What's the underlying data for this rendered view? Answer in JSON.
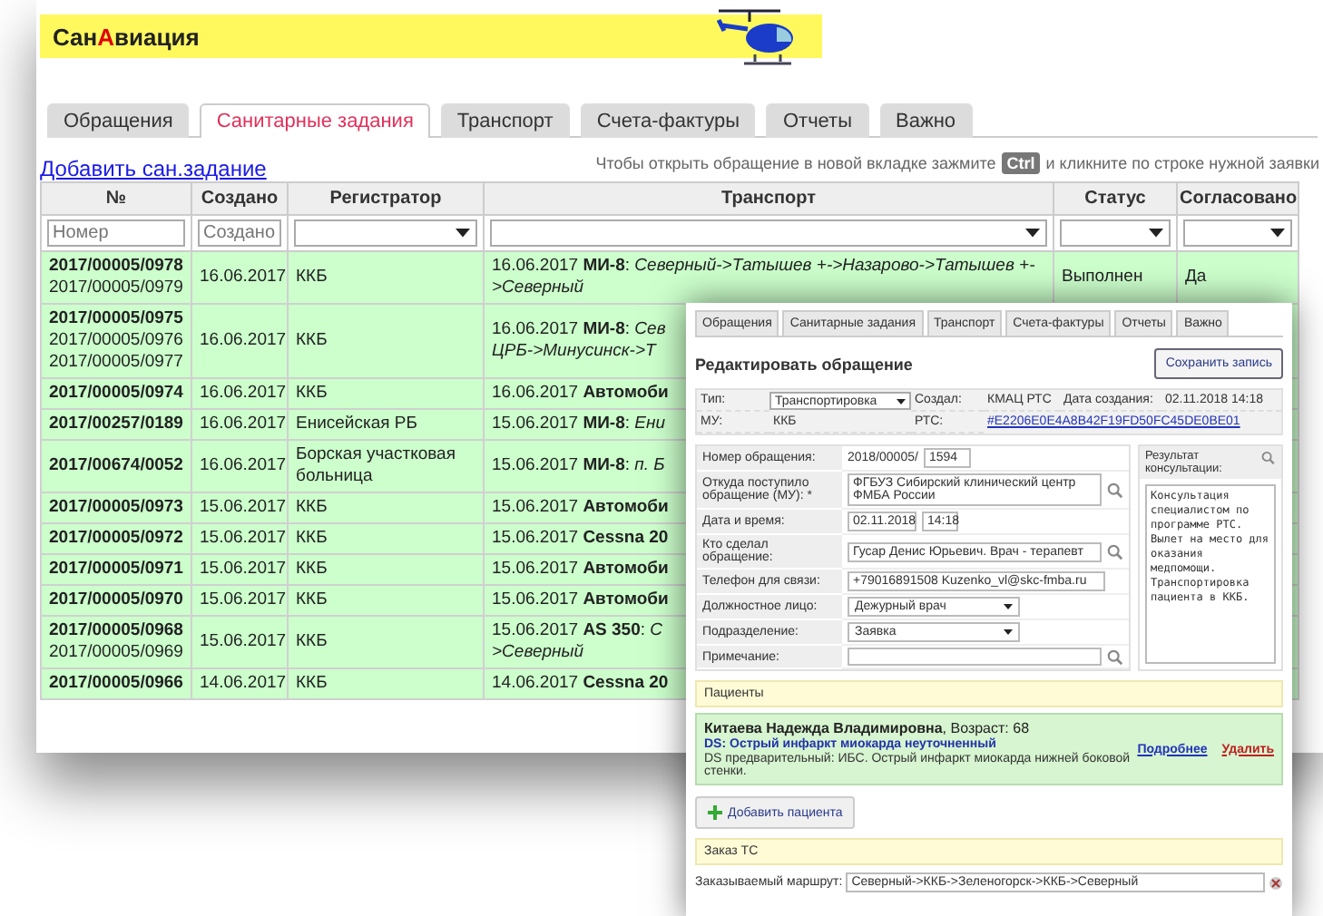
{
  "app": {
    "logo": {
      "before": "Сан",
      "accent": "А",
      "after": "виация"
    },
    "tabs": [
      {
        "label": "Обращения",
        "selected": false
      },
      {
        "label": "Санитарные задания",
        "selected": true
      },
      {
        "label": "Транспорт",
        "selected": false
      },
      {
        "label": "Счета-фактуры",
        "selected": false
      },
      {
        "label": "Отчеты",
        "selected": false
      },
      {
        "label": "Важно",
        "selected": false
      }
    ],
    "add_link": "Добавить сан.задание",
    "hint": {
      "before": "Чтобы открыть обращение в новой вкладке зажмите",
      "key": "Ctrl",
      "after": "и кликните по строке нужной заявки"
    },
    "table": {
      "columns": [
        "№",
        "Создано",
        "Регистратор",
        "Транспорт",
        "Статус",
        "Согласовано"
      ],
      "filters": [
        {
          "kind": "input",
          "placeholder": "Номер"
        },
        {
          "kind": "input",
          "placeholder": "Создано"
        },
        {
          "kind": "select"
        },
        {
          "kind": "select"
        },
        {
          "kind": "select"
        },
        {
          "kind": "select"
        }
      ],
      "rows": [
        {
          "numbers": [
            "2017/00005/0978",
            "2017/00005/0979"
          ],
          "created": "16.06.2017",
          "registrar": "ККБ",
          "transport": [
            "16.06.2017 **МИ-8**: *Северный->Татышев +->Назарово->Татышев +-*",
            "*>Северный*"
          ],
          "status": "Выполнен",
          "agreed": "Да"
        },
        {
          "numbers": [
            "2017/00005/0975",
            "2017/00005/0976",
            "2017/00005/0977"
          ],
          "created": "16.06.2017",
          "registrar": "ККБ",
          "transport": [
            "16.06.2017 **МИ-8**: *Сев*",
            "*ЦРБ->Минусинск->Т*"
          ]
        },
        {
          "numbers": [
            "2017/00005/0974"
          ],
          "created": "16.06.2017",
          "registrar": "ККБ",
          "transport": [
            "16.06.2017 **Автомоби**"
          ]
        },
        {
          "numbers": [
            "2017/00257/0189"
          ],
          "created": "16.06.2017",
          "registrar": "Енисейская РБ",
          "transport": [
            "15.06.2017 **МИ-8**: *Ени*"
          ]
        },
        {
          "numbers": [
            "2017/00674/0052"
          ],
          "created": "16.06.2017",
          "registrar": "Борская участковая больница",
          "transport": [
            "15.06.2017 **МИ-8**: *п. Б*"
          ]
        },
        {
          "numbers": [
            "2017/00005/0973"
          ],
          "created": "15.06.2017",
          "registrar": "ККБ",
          "transport": [
            "15.06.2017 **Автомоби**"
          ]
        },
        {
          "numbers": [
            "2017/00005/0972"
          ],
          "created": "15.06.2017",
          "registrar": "ККБ",
          "transport": [
            "15.06.2017 **Cessna 20**"
          ]
        },
        {
          "numbers": [
            "2017/00005/0971"
          ],
          "created": "15.06.2017",
          "registrar": "ККБ",
          "transport": [
            "15.06.2017 **Автомоби**"
          ]
        },
        {
          "numbers": [
            "2017/00005/0970"
          ],
          "created": "15.06.2017",
          "registrar": "ККБ",
          "transport": [
            "15.06.2017 **Автомоби**"
          ]
        },
        {
          "numbers": [
            "2017/00005/0968",
            "2017/00005/0969"
          ],
          "created": "15.06.2017",
          "registrar": "ККБ",
          "transport": [
            "15.06.2017 **AS 350**: *С*",
            "*>Северный*"
          ]
        },
        {
          "numbers": [
            "2017/00005/0966"
          ],
          "created": "14.06.2017",
          "registrar": "ККБ",
          "transport": [
            "14.06.2017 **Cessna 20**"
          ]
        }
      ]
    }
  },
  "editor": {
    "tabs": [
      {
        "label": "Обращения",
        "selected": false
      },
      {
        "label": "Санитарные задания",
        "selected": false
      },
      {
        "label": "Транспорт",
        "selected": false
      },
      {
        "label": "Счета-фактуры",
        "selected": false
      },
      {
        "label": "Отчеты",
        "selected": false
      },
      {
        "label": "Важно",
        "selected": false
      }
    ],
    "title": "Редактировать обращение",
    "save_button": "Сохранить запись",
    "info": {
      "type_label": "Тип:",
      "type_value": "Транспортировка",
      "creator_label": "Создал:",
      "creator": "КМАЦ РТС",
      "created_label": "Дата создания:",
      "created": "02.11.2018 14:18",
      "mu_label": "МУ:",
      "mu": "ККБ",
      "rts_label": "РТС:",
      "rts": "#E2206E0E4A8B42F19FD50FC45DE0BE01"
    },
    "form": [
      {
        "kind": "number",
        "label": "Номер обращения:",
        "prefix": "2018/00005/",
        "value": "1594"
      },
      {
        "kind": "lookup",
        "label": "Откуда поступило обращение (МУ): *",
        "value": "ФГБУЗ Сибирский клинический центр ФМБА России"
      },
      {
        "kind": "datetime",
        "label": "Дата и время:",
        "date": "02.11.2018",
        "time": "14:18"
      },
      {
        "kind": "lookup",
        "label": "Кто сделал обращение:",
        "value": "Гусар Денис Юрьевич. Врач - терапевт"
      },
      {
        "kind": "text",
        "label": "Телефон для связи:",
        "value": "+79016891508  Kuzenko_vl@skc-fmba.ru"
      },
      {
        "kind": "select",
        "label": "Должностное лицо:",
        "value": "Дежурный врач"
      },
      {
        "kind": "select",
        "label": "Подразделение:",
        "value": "Заявка"
      },
      {
        "kind": "lookup",
        "label": "Примечание:"
      }
    ],
    "result": {
      "label": "Результат консультации:",
      "text": "Консультация специалистом по программе РТС. Вылет на место для оказания медпомощи. Транспортировка пациента в ККБ."
    },
    "patients": {
      "title": "Пациенты",
      "items": [
        {
          "name": "**Китаева Надежда Владимировна**, Возраст: 68",
          "ds": "DS: Острый инфаркт миокарда неуточненный",
          "ds_pre": "DS предварительный: ИБС. Острый инфаркт миокарда нижней боковой стенки.",
          "details_link": "Подробнее",
          "delete_link": "Удалить"
        }
      ],
      "add_button": "Добавить пациента"
    },
    "order": {
      "title": "Заказ ТС",
      "route_label": "Заказываемый маршрут:",
      "route": "Северный->ККБ->Зеленогорск->ККБ->Северный"
    }
  }
}
